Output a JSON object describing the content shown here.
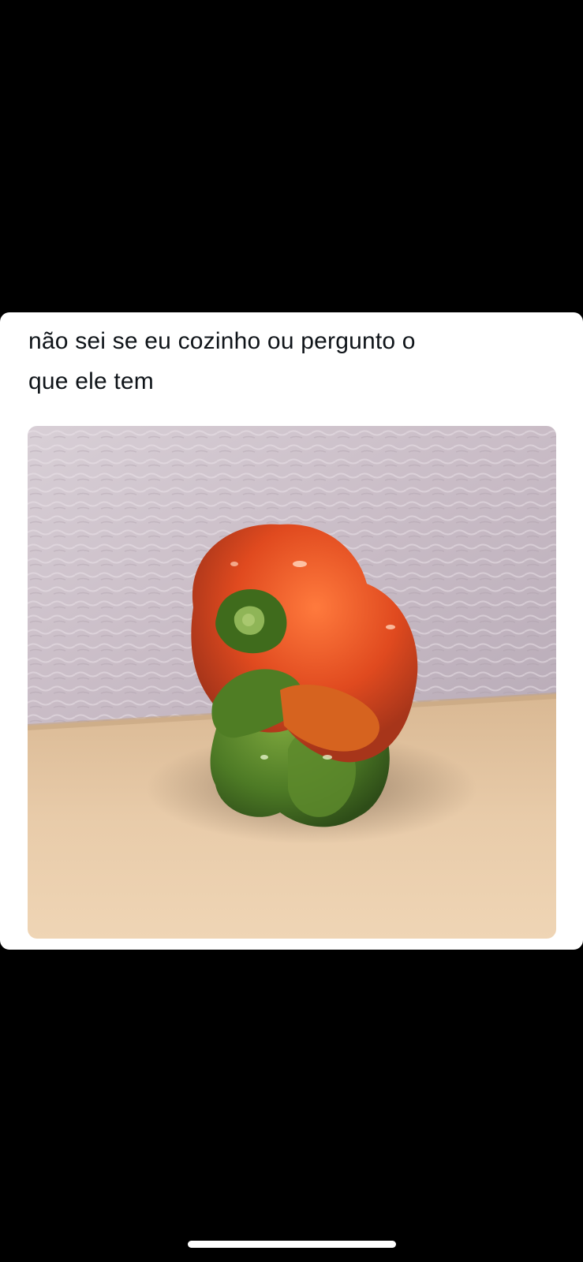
{
  "post": {
    "text": "não sei se eu cozinho ou pergunto o\nque ele tem"
  },
  "media": {
    "icon": "photo-of-bell-pepper",
    "colors": {
      "wall": "#c9bdc6",
      "table": "#e6c8a6",
      "pepper_red": "#e0491f",
      "pepper_green": "#4d7a25"
    }
  },
  "system": {
    "background": "#000000",
    "card_background": "#ffffff"
  }
}
